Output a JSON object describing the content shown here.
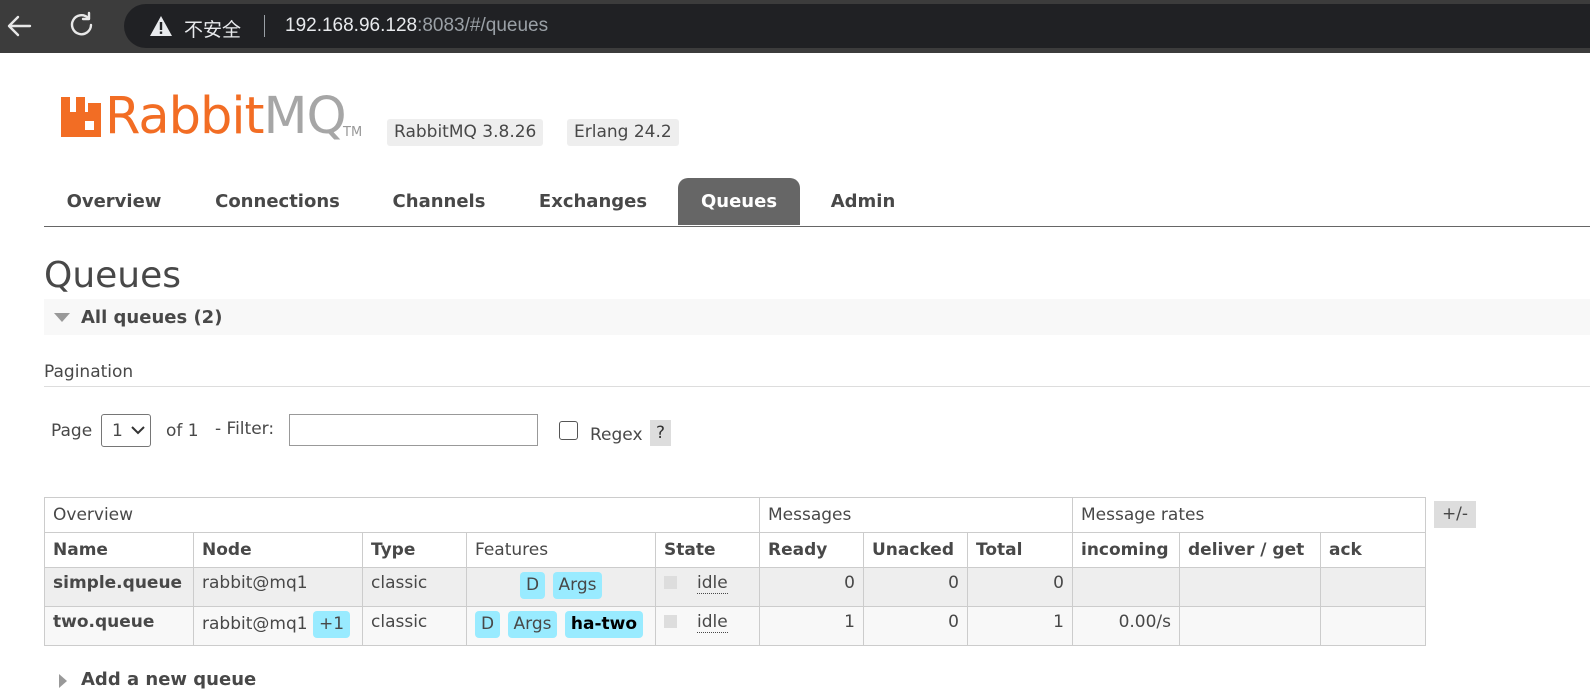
{
  "browser": {
    "security_label": "不安全",
    "url_host": "192.168.96.128",
    "url_rest": ":8083/#/queues"
  },
  "header": {
    "logo_rabbit": "Rabbit",
    "logo_mq": "MQ",
    "logo_tm": "TM",
    "rabbitmq_version": "RabbitMQ 3.8.26",
    "erlang_version": "Erlang 24.2"
  },
  "tabs": [
    {
      "label": "Overview",
      "active": false
    },
    {
      "label": "Connections",
      "active": false
    },
    {
      "label": "Channels",
      "active": false
    },
    {
      "label": "Exchanges",
      "active": false
    },
    {
      "label": "Queues",
      "active": true
    },
    {
      "label": "Admin",
      "active": false
    }
  ],
  "page": {
    "title": "Queues",
    "section_title": "All queues (2)",
    "pagination_title": "Pagination"
  },
  "pager": {
    "page_label": "Page",
    "page_value": "1",
    "of_label": "of 1",
    "filter_label": "- Filter:",
    "filter_value": "",
    "regex_label": "Regex",
    "regex_checked": false,
    "help_label": "?"
  },
  "table": {
    "groups": [
      "Overview",
      "Messages",
      "Message rates"
    ],
    "columns": [
      "Name",
      "Node",
      "Type",
      "Features",
      "State",
      "Ready",
      "Unacked",
      "Total",
      "incoming",
      "deliver / get",
      "ack"
    ],
    "toggle_label": "+/-",
    "rows": [
      {
        "name": "simple.queue",
        "node": "rabbit@mq1",
        "node_extra": "",
        "type": "classic",
        "features": [
          "D",
          "Args"
        ],
        "policy": "",
        "state": "idle",
        "ready": "0",
        "unacked": "0",
        "total": "0",
        "incoming": "",
        "deliver_get": "",
        "ack": ""
      },
      {
        "name": "two.queue",
        "node": "rabbit@mq1",
        "node_extra": "+1",
        "type": "classic",
        "features": [
          "D",
          "Args"
        ],
        "policy": "ha-two",
        "state": "idle",
        "ready": "1",
        "unacked": "0",
        "total": "1",
        "incoming": "0.00/s",
        "deliver_get": "",
        "ack": ""
      }
    ]
  },
  "add_queue": {
    "label": "Add a new queue"
  },
  "colors": {
    "brand_orange": "#f26d24",
    "tag_blue": "#99ebff",
    "active_tab": "#666666"
  }
}
